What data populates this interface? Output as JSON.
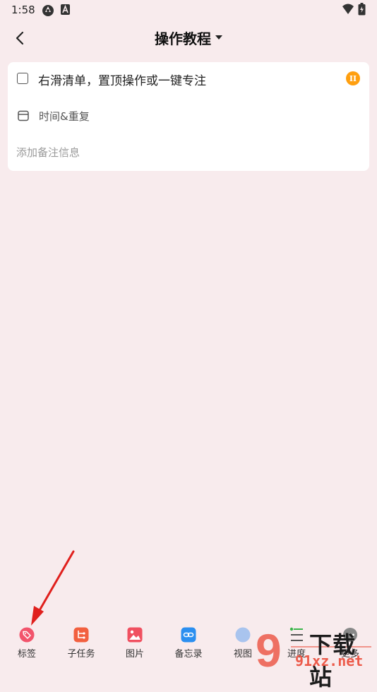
{
  "status_bar": {
    "time": "1:58"
  },
  "header": {
    "title": "操作教程"
  },
  "task": {
    "title": "右滑清单，置顶操作或一键专注",
    "priority": "II",
    "time_label": "时间&重复",
    "note_placeholder": "添加备注信息"
  },
  "toolbar": {
    "items": [
      {
        "label": "标签",
        "icon": "tag-icon",
        "color": "#f2546c"
      },
      {
        "label": "子任务",
        "icon": "subtask-icon",
        "color": "#f2603f"
      },
      {
        "label": "图片",
        "icon": "image-icon",
        "color": "#f05060"
      },
      {
        "label": "备忘录",
        "icon": "memo-icon",
        "color": "#2b8ff0"
      },
      {
        "label": "视图",
        "icon": "view-icon",
        "color": "#a9c4ee"
      },
      {
        "label": "进度",
        "icon": "progress-icon",
        "color": "#3ab54a"
      },
      {
        "label": "更多",
        "icon": "more-icon",
        "color": "#888888"
      }
    ]
  },
  "colors": {
    "background": "#f8ebed",
    "priority": "#ff9f0f",
    "annotation_arrow": "#e0201d"
  },
  "watermark": {
    "text": "下载站",
    "url_text": "91xz.net"
  }
}
